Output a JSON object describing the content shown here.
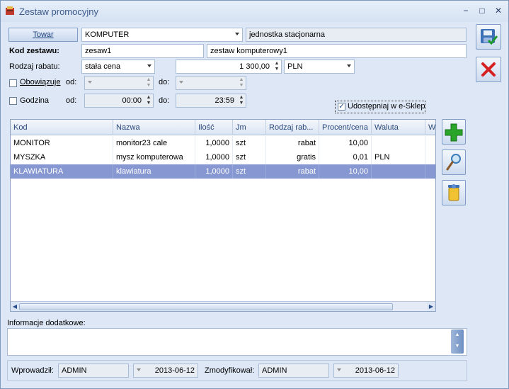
{
  "window": {
    "title": "Zestaw promocyjny",
    "controls": [
      "−",
      "□",
      "✕"
    ]
  },
  "form": {
    "towar_button": "Towar",
    "towar_value": "KOMPUTER",
    "towar_unit": "jednostka stacjonarna",
    "kod_label": "Kod zestawu:",
    "kod_value": "zesaw1",
    "nazwa_value": "zestaw komputerowy1",
    "rabat_label": "Rodzaj rabatu:",
    "rabat_type": "stała cena",
    "rabat_amount": "1 300,00",
    "currency": "PLN",
    "obowiazuje_label": "Obowiązuje",
    "obowiazuje_checked": false,
    "od_label": "od:",
    "do_label": "do:",
    "godzina_label": "Godzina",
    "godzina_checked": false,
    "godzina_od": "00:00",
    "godzina_do": "23:59",
    "esklep_label": "Udostępniaj w e-Sklep",
    "esklep_checked": true
  },
  "table": {
    "columns": [
      "Kod",
      "Nazwa",
      "Ilość",
      "Jm",
      "Rodzaj rab...",
      "Procent/cena",
      "Waluta",
      "W"
    ],
    "rows": [
      {
        "kod": "MONITOR",
        "nazwa": "monitor23 cale",
        "ilosc": "1,0000",
        "jm": "szt",
        "rodzaj": "rabat",
        "procent": "10,00",
        "waluta": ""
      },
      {
        "kod": "MYSZKA",
        "nazwa": "mysz komputerowa",
        "ilosc": "1,0000",
        "jm": "szt",
        "rodzaj": "gratis",
        "procent": "0,01",
        "waluta": "PLN"
      },
      {
        "kod": "KLAWIATURA",
        "nazwa": "klawiatura",
        "ilosc": "1,0000",
        "jm": "szt",
        "rodzaj": "rabat",
        "procent": "10,00",
        "waluta": ""
      }
    ],
    "selected_row": 2
  },
  "info": {
    "label": "Informacje dodatkowe:",
    "value": ""
  },
  "footer": {
    "wprowadzil_label": "Wprowadził:",
    "wprowadzil_user": "ADMIN",
    "wprowadzil_date": "2013-06-12",
    "zmodyfikowal_label": "Zmodyfikował:",
    "zmodyfikowal_user": "ADMIN",
    "zmodyfikowal_date": "2013-06-12"
  },
  "icons": {
    "save": "save-check-icon",
    "cancel": "red-x-icon",
    "add": "green-plus-icon",
    "edit": "magnifier-icon",
    "delete": "trash-icon"
  },
  "colors": {
    "selected_row": "#8797d2",
    "title_text": "#3a5a8c",
    "accent_red": "#d42020",
    "accent_green": "#2aa52a"
  }
}
